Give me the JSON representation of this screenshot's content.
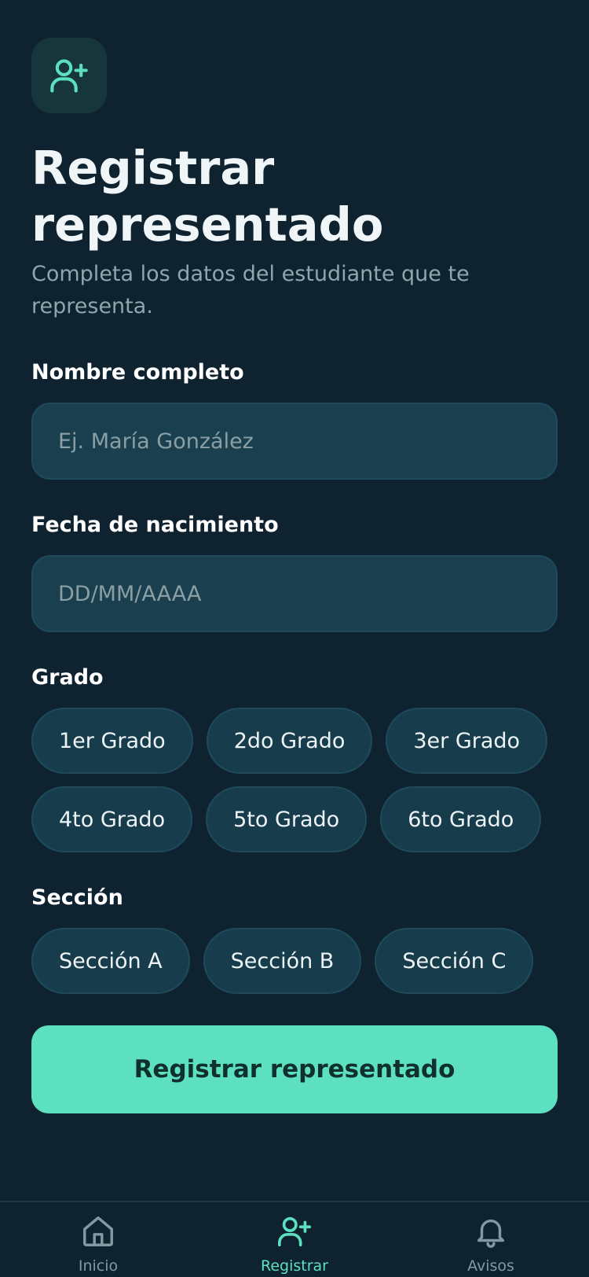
{
  "header": {
    "icon": "user-plus-icon",
    "title": "Registrar representado",
    "subtitle": "Completa los datos del estudiante que te representa."
  },
  "form": {
    "name": {
      "label": "Nombre completo",
      "placeholder": "Ej. María González",
      "value": ""
    },
    "birthdate": {
      "label": "Fecha de nacimiento",
      "placeholder": "DD/MM/AAAA",
      "value": ""
    },
    "grade": {
      "label": "Grado",
      "options": [
        "1er Grado",
        "2do Grado",
        "3er Grado",
        "4to Grado",
        "5to Grado",
        "6to Grado"
      ]
    },
    "section": {
      "label": "Sección",
      "options": [
        "Sección A",
        "Sección B",
        "Sección C"
      ]
    },
    "submit_label": "Registrar representado"
  },
  "nav": {
    "items": [
      {
        "label": "Inicio",
        "icon": "home-icon",
        "active": false
      },
      {
        "label": "Registrar",
        "icon": "user-plus-icon",
        "active": true
      },
      {
        "label": "Avisos",
        "icon": "bell-icon",
        "active": false
      }
    ]
  },
  "colors": {
    "background": "#0f2230",
    "accent": "#5de0c0",
    "input_bg": "#1a4050",
    "chip_bg": "#173c4c"
  }
}
